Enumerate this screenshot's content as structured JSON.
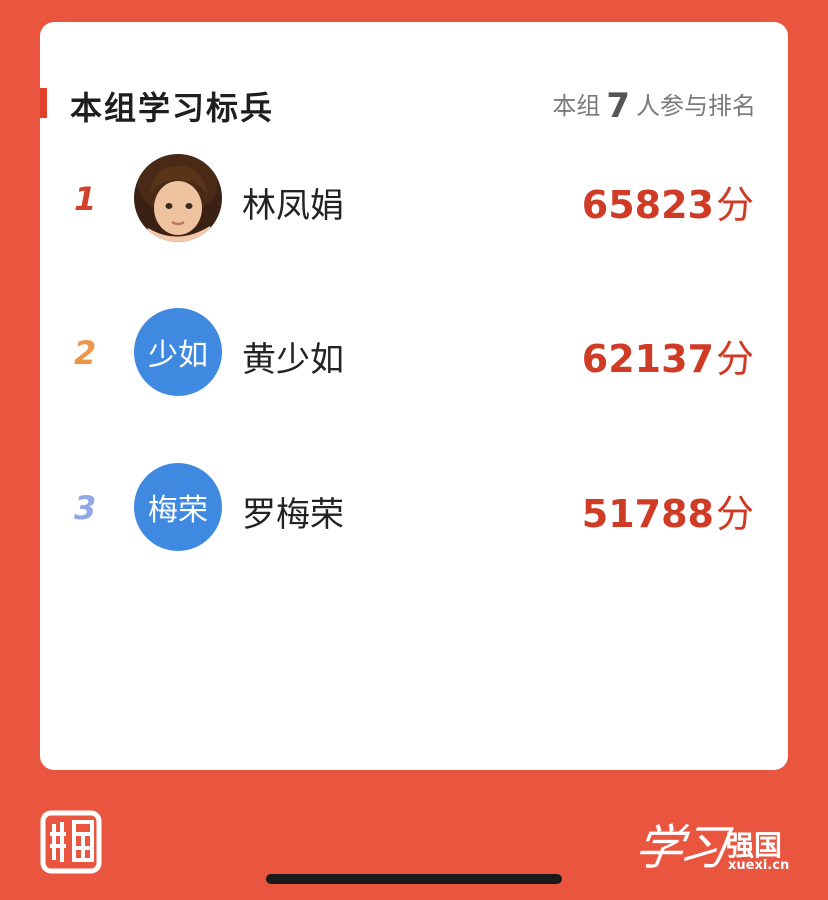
{
  "card": {
    "title": "本组学习标兵",
    "participants_prefix": "本组",
    "participants_count": "7",
    "participants_suffix": "人参与排名"
  },
  "leaders": [
    {
      "rank": "1",
      "name": "林凤娟",
      "avatar_text": "",
      "score": "65823",
      "unit": "分",
      "rank_color": "#d2412c"
    },
    {
      "rank": "2",
      "name": "黄少如",
      "avatar_text": "少如",
      "score": "62137",
      "unit": "分",
      "rank_color": "#f0944a"
    },
    {
      "rank": "3",
      "name": "罗梅荣",
      "avatar_text": "梅荣",
      "score": "51788",
      "unit": "分",
      "rank_color": "#8fa9e6"
    }
  ],
  "footer": {
    "logo_calligraphy": "学习",
    "logo_text": "强国",
    "logo_site": "xuexi.cn"
  },
  "colors": {
    "background": "#e9553f",
    "accent": "#e0412a",
    "score": "#cf3b25",
    "avatar_blue": "#3f8ae0"
  }
}
